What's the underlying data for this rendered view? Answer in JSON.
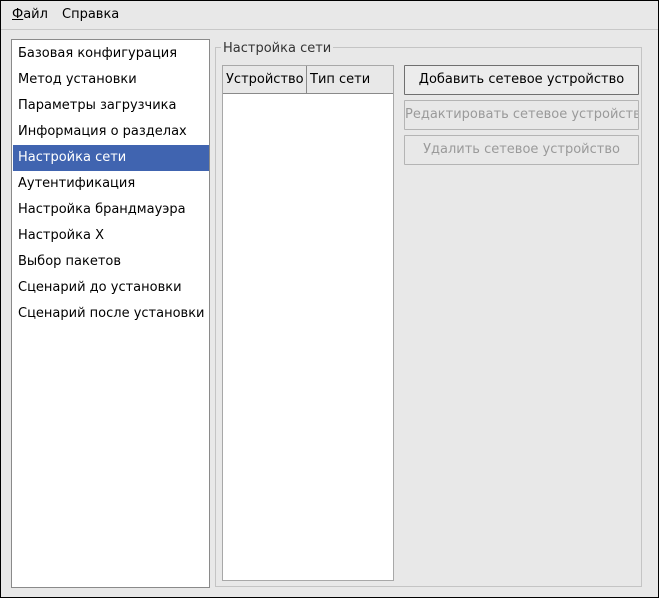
{
  "menubar": {
    "file_label": "Файл",
    "help_label": "Справка"
  },
  "sidebar": {
    "selected_index": 4,
    "items": [
      {
        "label": "Базовая конфигурация"
      },
      {
        "label": "Метод установки"
      },
      {
        "label": "Параметры загрузчика"
      },
      {
        "label": "Информация о разделах"
      },
      {
        "label": "Настройка сети"
      },
      {
        "label": "Аутентификация"
      },
      {
        "label": "Настройка брандмауэра"
      },
      {
        "label": "Настройка X"
      },
      {
        "label": "Выбор пакетов"
      },
      {
        "label": "Сценарий до установки"
      },
      {
        "label": "Сценарий после установки"
      }
    ]
  },
  "network_panel": {
    "title": "Настройка сети",
    "table": {
      "columns": [
        "Устройство",
        "Тип сети"
      ],
      "rows": []
    },
    "buttons": {
      "add": "Добавить сетевое устройство",
      "edit": "Редактировать сетевое устройство",
      "delete": "Удалить сетевое устройство"
    }
  },
  "colors": {
    "selection": "#4064b0",
    "window_bg": "#e8e8e8",
    "disabled_text": "#9a9a9a"
  }
}
